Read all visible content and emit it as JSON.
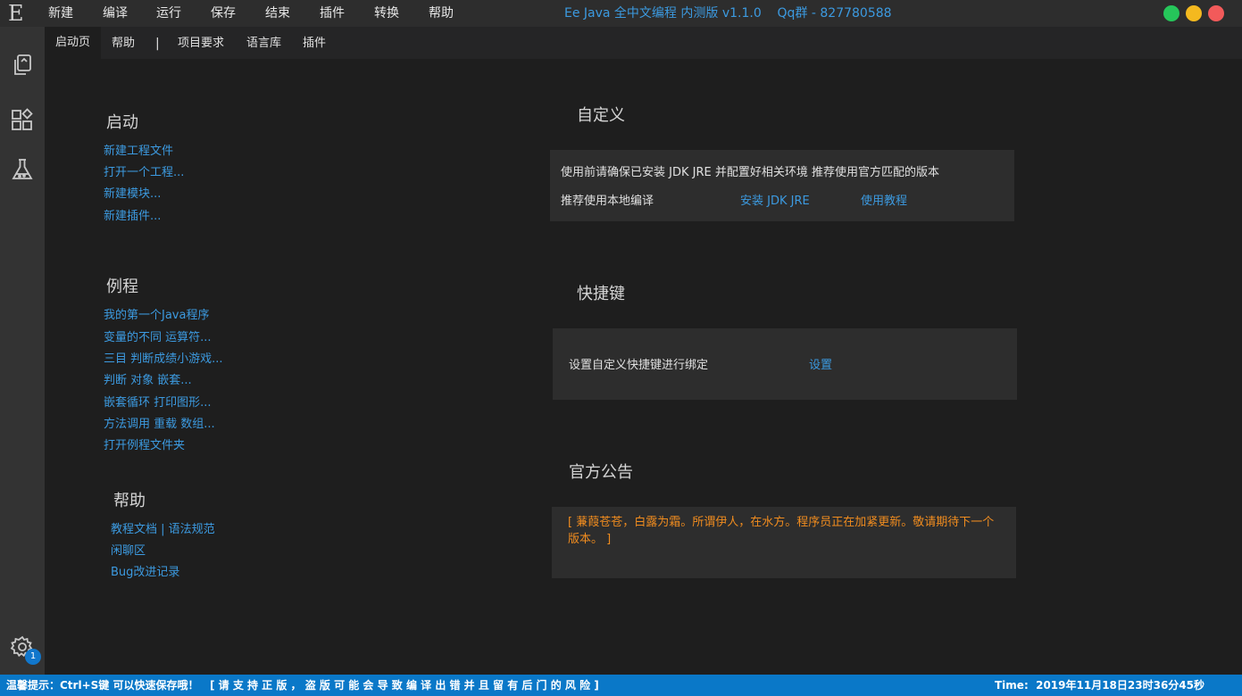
{
  "menubar": {
    "logo": "E",
    "items": [
      "新建",
      "编译",
      "运行",
      "保存",
      "结束",
      "插件",
      "转换",
      "帮助"
    ],
    "title": "Ee Java 全中文编程 内测版 v1.1.0    Qq群 - 827780588",
    "window_buttons": {
      "green": "#26c65a",
      "yellow": "#f4b91f",
      "red": "#f25a5a"
    }
  },
  "tabs": {
    "items": [
      "启动页",
      "帮助",
      "|",
      "项目要求",
      "语言库",
      "插件"
    ]
  },
  "activity": {
    "icons": [
      "files-icon",
      "extensions-icon",
      "flask-icon",
      "gear-icon"
    ],
    "badge": "1"
  },
  "start": {
    "title": "启动",
    "links": [
      "新建工程文件",
      "打开一个工程...",
      "新建模块...",
      "新建插件..."
    ]
  },
  "examples": {
    "title": "例程",
    "links": [
      "我的第一个Java程序",
      "变量的不同 运算符...",
      "三目 判断成绩小游戏...",
      "判断 对象 嵌套...",
      "嵌套循环 打印图形...",
      "方法调用 重载 数组...",
      "打开例程文件夹"
    ]
  },
  "help": {
    "title": "帮助",
    "links": [
      "教程文档 | 语法规范",
      "闲聊区",
      "Bug改进记录"
    ]
  },
  "custom": {
    "title": "自定义",
    "line1": "使用前请确保已安装 JDK JRE 并配置好相关环境 推荐使用官方匹配的版本",
    "line2": "推荐使用本地编译",
    "install_link": "安装 JDK JRE",
    "tutorial_link": "使用教程"
  },
  "shortcuts": {
    "title": "快捷键",
    "text": "设置自定义快捷键进行绑定",
    "setting_link": "设置"
  },
  "announcement": {
    "title": "官方公告",
    "text": "[ 蒹葭苍苍，白露为霜。所谓伊人，在水方。程序员正在加紧更新。敬请期待下一个版本。 ]"
  },
  "status": {
    "tip": "温馨提示：Ctrl+S键 可以快速保存哦！   [ 请 支 持 正 版 ， 盗 版 可 能 会 导 致 编 译 出 错 并 且 留 有 后 门 的 风 险 ]",
    "time": "Time:  2019年11月18日23时36分45秒"
  }
}
